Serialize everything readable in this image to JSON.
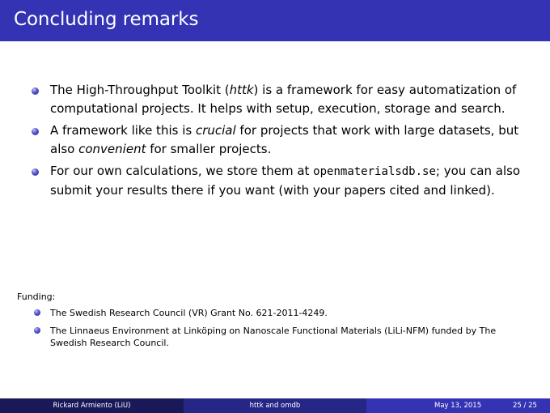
{
  "slide": {
    "title": "Concluding remarks"
  },
  "bullets": [
    {
      "t1": "The High-Throughput Toolkit (",
      "em1": "httk",
      "t2": ") is a framework for easy automatization of computational projects. It helps with setup, execution, storage and search."
    },
    {
      "t1": "A framework like this is ",
      "em1": "crucial",
      "t2": " for projects that work with large datasets, but also ",
      "em2": "convenient",
      "t3": " for smaller projects."
    },
    {
      "t1": "For our own calculations, we store them at ",
      "code": "openmaterialsdb.se",
      "t2": "; you can also submit your results there if you want (with your papers cited and linked)."
    }
  ],
  "funding": {
    "label": "Funding:",
    "items": [
      "The Swedish Research Council (VR) Grant No. 621-2011-4249.",
      "The Linnaeus Environment at Linköping on Nanoscale Functional Materials (LiLi-NFM) funded by The Swedish Research Council."
    ]
  },
  "footer": {
    "author": "Rickard Armiento  (LiU)",
    "short_title": "httk and omdb",
    "date": "May 13, 2015",
    "page": "25 / 25"
  }
}
